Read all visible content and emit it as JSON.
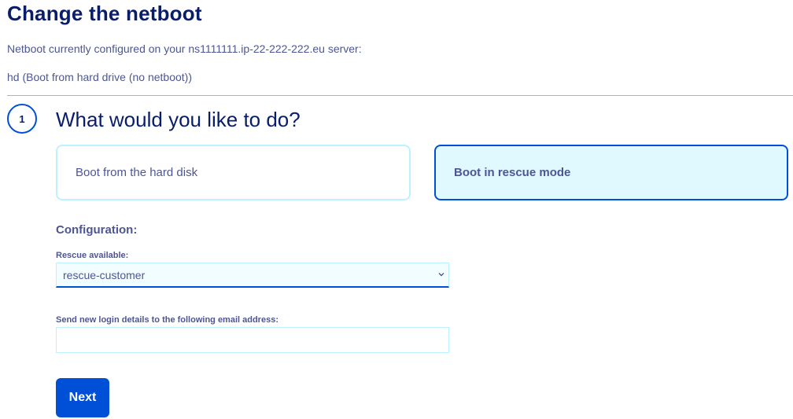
{
  "page": {
    "title": "Change the netboot",
    "current_config_text": "Netboot currently configured on your ns1111111.ip-22-222-222.eu server:",
    "current_config_value": "hd (Boot from hard drive (no netboot))"
  },
  "step": {
    "number": "1",
    "title": "What would you like to do?",
    "options": [
      {
        "label": "Boot from the hard disk",
        "selected": false
      },
      {
        "label": "Boot in rescue mode",
        "selected": true
      }
    ]
  },
  "configuration": {
    "section_label": "Configuration:",
    "rescue_label": "Rescue available:",
    "rescue_value": "rescue-customer",
    "email_label": "Send new login details to the following email address:",
    "email_value": "",
    "email_placeholder": ""
  },
  "actions": {
    "next_label": "Next"
  },
  "colors": {
    "primary": "#0050d7",
    "title": "#0a1d6b",
    "text": "#4d5693",
    "selected_bg": "#e0f8ff",
    "border_light": "#bef1ff"
  },
  "icons": {
    "select": "chevron-down-icon"
  }
}
